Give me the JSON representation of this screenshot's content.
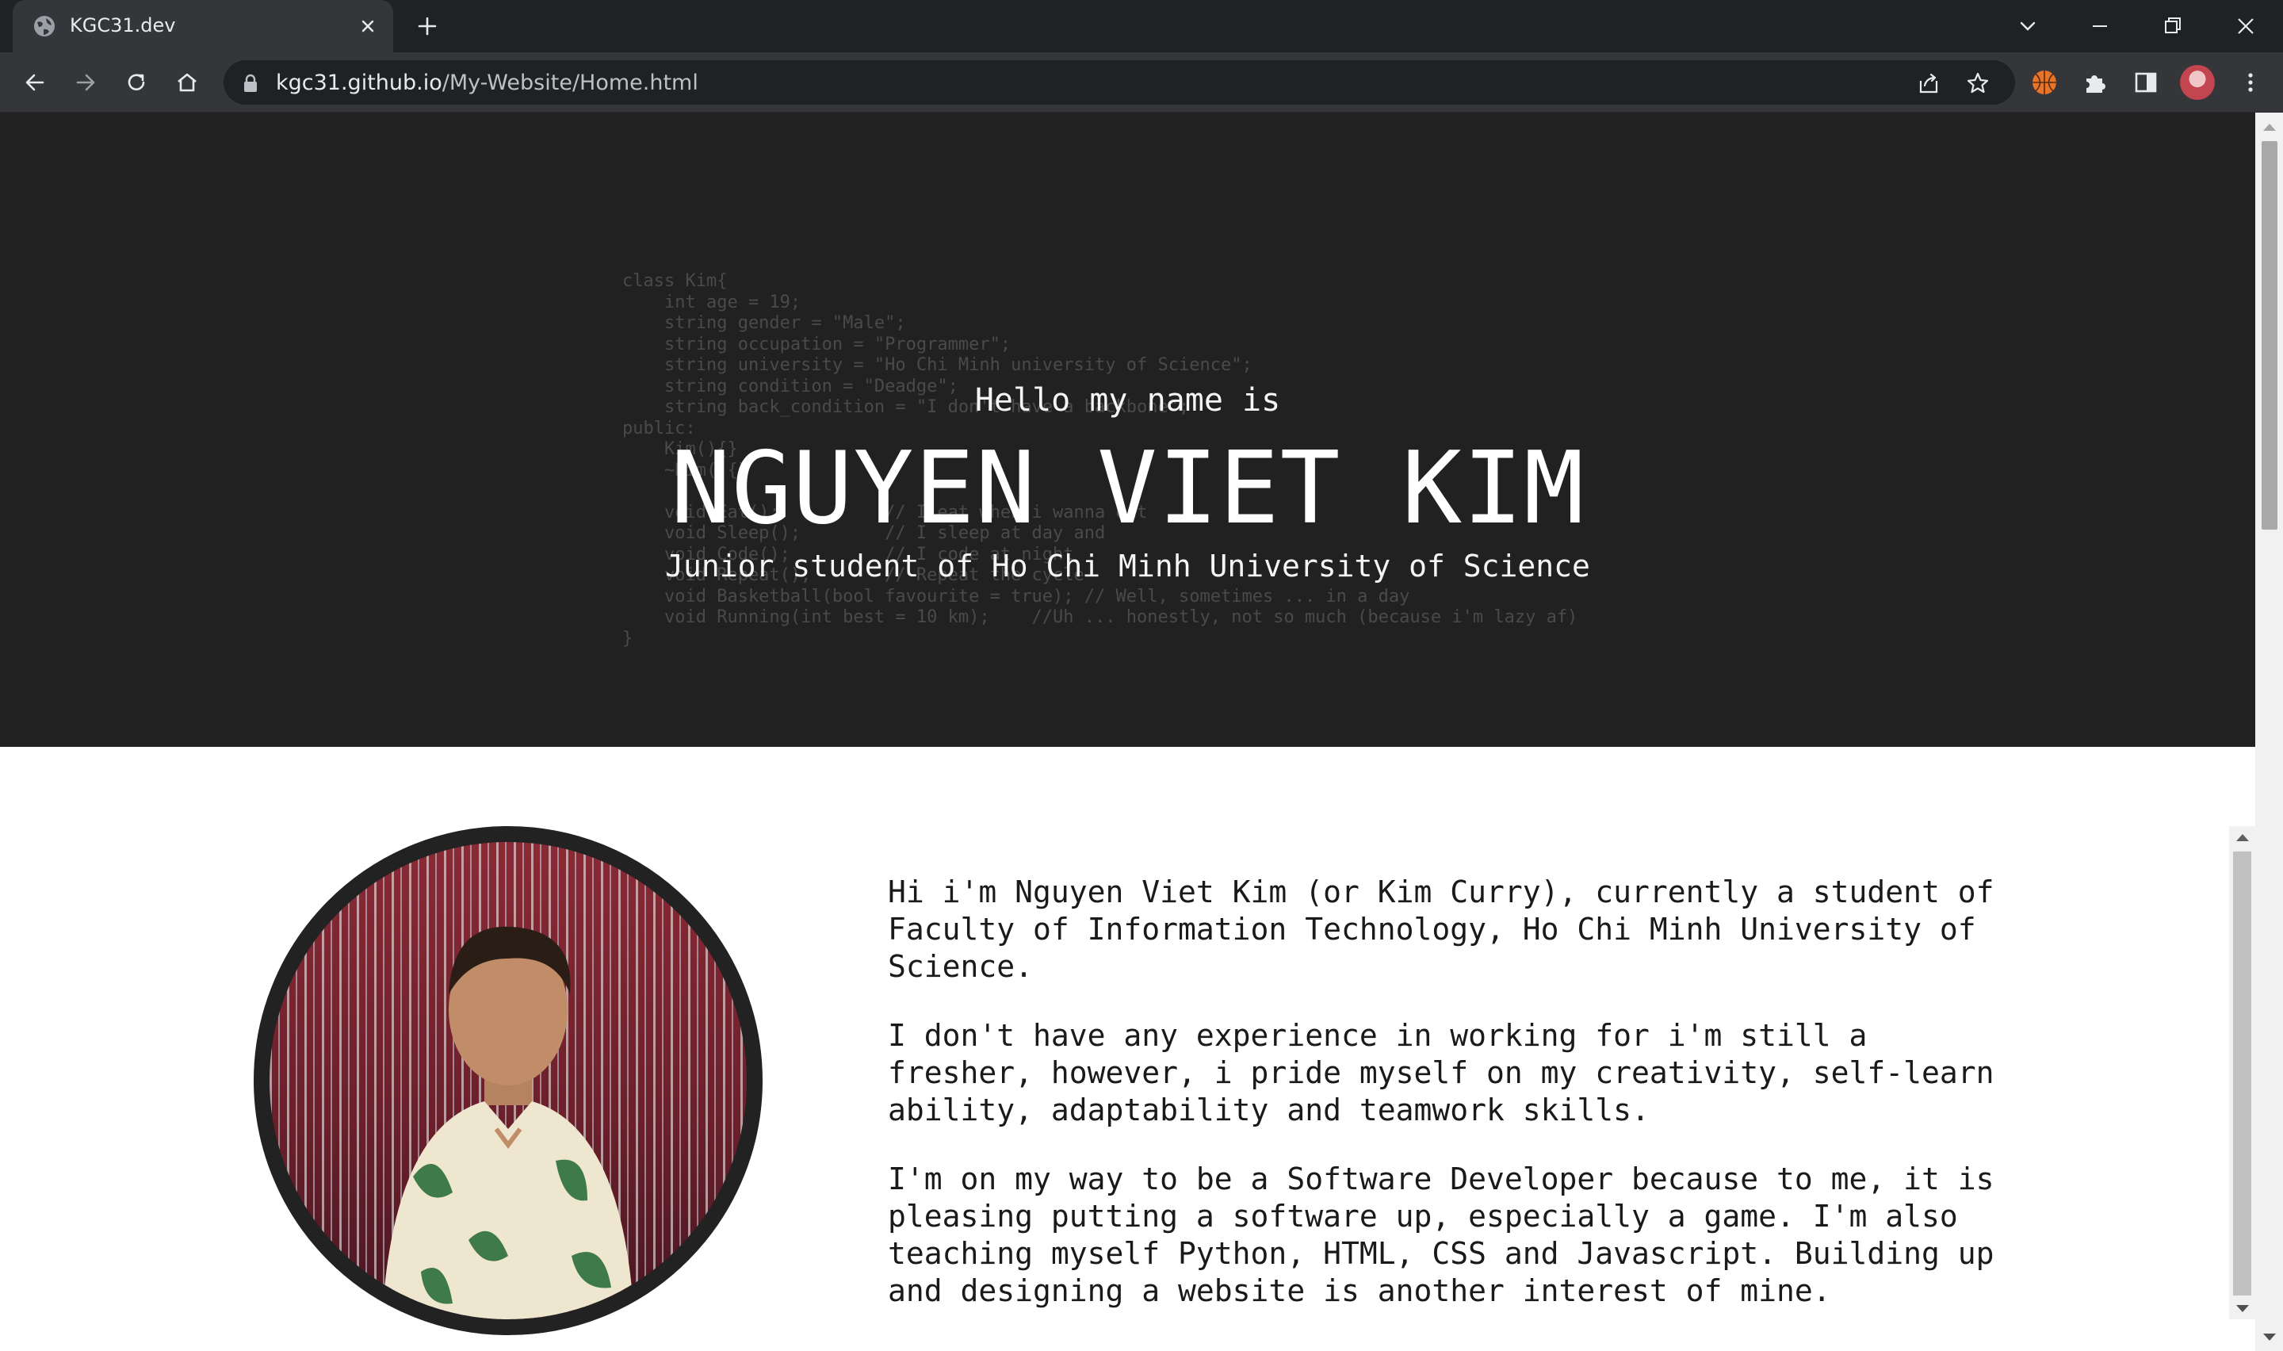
{
  "browser": {
    "tab_title": "KGC31.dev",
    "url_host": "kgc31.github.io",
    "url_path": "/My-Website/Home.html"
  },
  "hero": {
    "hello": "Hello my name is",
    "name": "NGUYEN VIET KIM",
    "subtitle": "Junior student of Ho Chi Minh University of Science",
    "code_lines": [
      "class Kim{",
      "    int age = 19;",
      "    string gender = \"Male\";",
      "    string occupation = \"Programmer\";",
      "    string university = \"Ho Chi Minh university of Science\";",
      "    string condition = \"Deadge\";",
      "    string back_condition = \"I don't have a backbone\";",
      "public:",
      "    Kim(){}",
      "    ~Kim(){}",
      "",
      "    void Eat();          // I eat when i wanna eat",
      "    void Sleep();        // I sleep at day and",
      "    void Code();         // I code at night",
      "    void Repeat();       // Repeat the cycle",
      "    void Basketball(bool favourite = true); // Well, sometimes ... in a day",
      "    void Running(int best = 10 km);    //Uh ... honestly, not so much (because i'm lazy af)",
      "}"
    ]
  },
  "about": {
    "paragraphs": [
      "Hi i'm Nguyen Viet Kim (or Kim Curry), currently a student of Faculty of Information Technology, Ho Chi Minh University of Science.",
      "I don't have any experience in working for i'm still a fresher, however, i pride myself on my creativity, self-learn ability, adaptability and teamwork skills.",
      "I'm on my way to be a Software Developer because to me, it is pleasing putting a software up, especially a game. I'm also teaching myself Python, HTML, CSS and Javascript. Building up and designing a website is another interest of mine."
    ]
  },
  "icons": {
    "favicon": "globe-icon",
    "close": "close-icon",
    "new_tab": "plus-icon",
    "back": "back-arrow-icon",
    "forward": "forward-arrow-icon",
    "reload": "reload-icon",
    "home": "home-icon",
    "lock": "lock-icon",
    "share": "share-icon",
    "bookmark": "star-icon",
    "extension_basketball": "basketball-icon",
    "extensions": "puzzle-icon",
    "side_panel": "side-panel-icon",
    "menu": "kebab-menu-icon"
  },
  "colors": {
    "hero_bg": "#212121",
    "chrome_dark": "#202124",
    "chrome_toolbar": "#35363a",
    "text_dark": "#1a1a1a"
  }
}
